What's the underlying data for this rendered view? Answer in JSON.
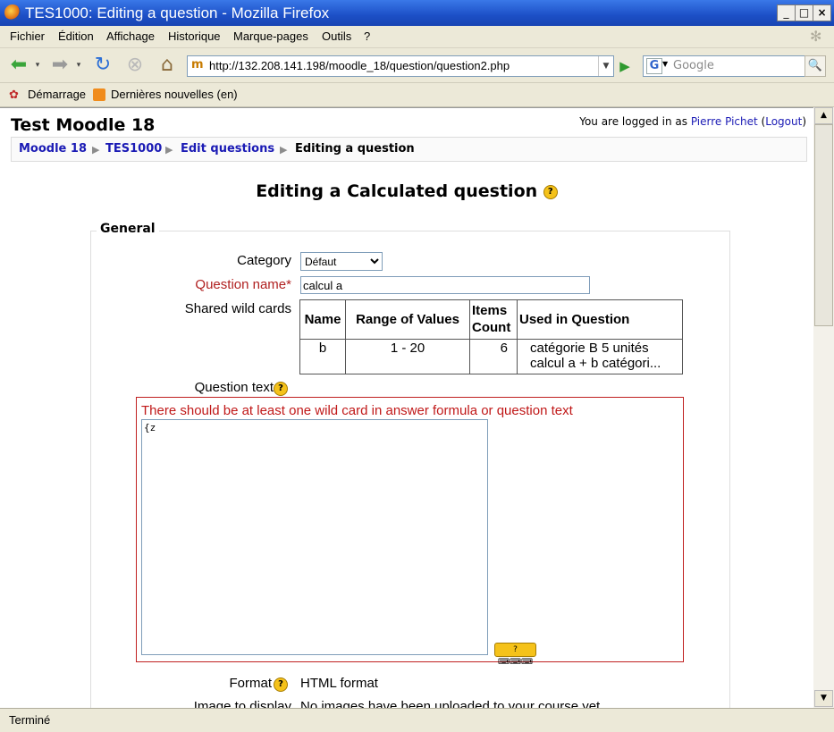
{
  "window": {
    "title": "TES1000: Editing a question - Mozilla Firefox",
    "min": "_",
    "max": "□",
    "close": "×"
  },
  "menu": {
    "items": [
      "Fichier",
      "Édition",
      "Affichage",
      "Historique",
      "Marque-pages",
      "Outils",
      "?"
    ]
  },
  "nav": {
    "url": "http://132.208.141.198/moodle_18/question/question2.php",
    "search_engine": "G",
    "search_placeholder": "Google"
  },
  "bookmarks": {
    "items": [
      "Démarrage",
      "Dernières nouvelles (en)"
    ]
  },
  "page": {
    "site_title": "Test Moodle 18",
    "login_prefix": "You are logged in as ",
    "login_user": "Pierre Pichet",
    "logout": "Logout",
    "breadcrumb": [
      "Moodle 18",
      "TES1000",
      "Edit questions",
      "Editing a question"
    ],
    "heading": "Editing a Calculated question",
    "legend": "General",
    "category_label": "Category",
    "category_value": "Défaut",
    "question_name_label": "Question name",
    "required_mark": "*",
    "question_name_value": "calcul a",
    "shared_label": "Shared wild cards",
    "wild_table": {
      "headers": [
        "Name",
        "Range of Values",
        "Items Count",
        "Used in Question"
      ],
      "rows": [
        [
          "b",
          "1 - 20",
          "6",
          "catégorie B 5 unités calcul a + b catégori..."
        ]
      ]
    },
    "question_text_label": "Question text",
    "error": "There should be at least one wild card in answer formula or question text",
    "question_text_value": "{z",
    "format_label": "Format",
    "format_value": "HTML format",
    "image_label": "Image to display",
    "image_value": "No images have been uploaded to your course yet"
  },
  "status": {
    "text": "Terminé"
  }
}
